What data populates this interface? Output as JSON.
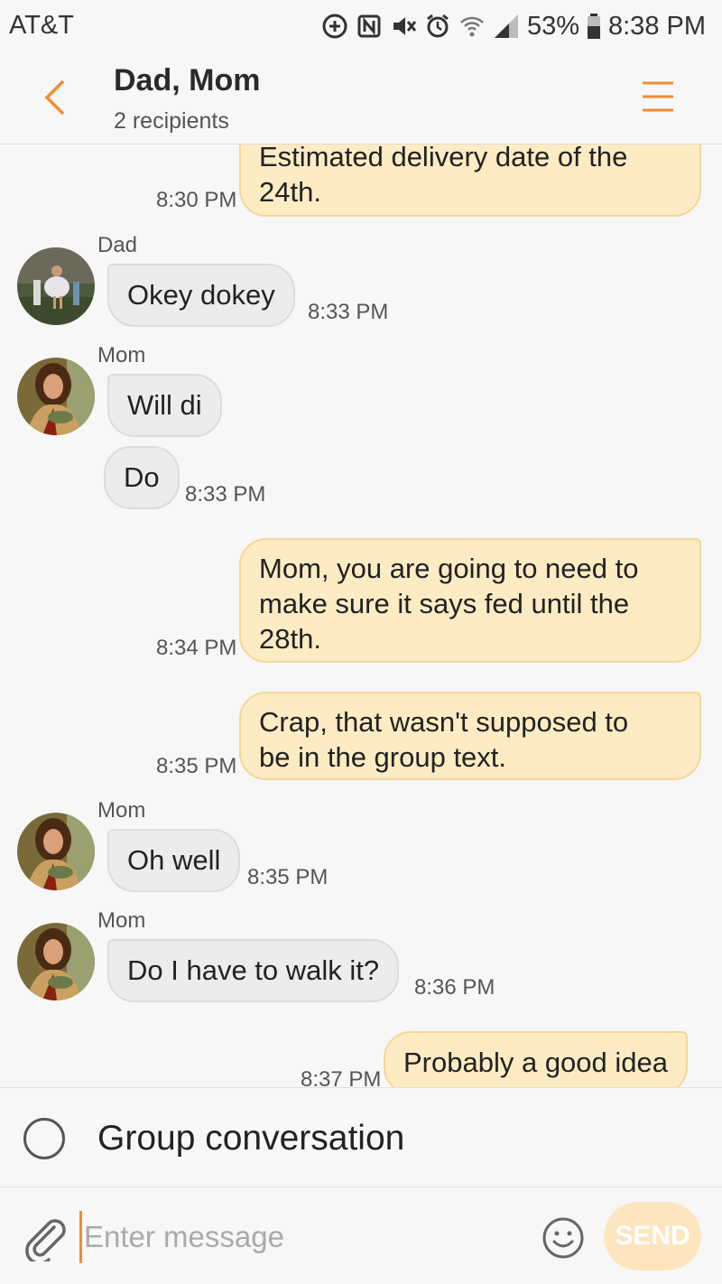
{
  "statusbar": {
    "carrier": "AT&T",
    "battery": "53%",
    "time": "8:38 PM",
    "icons": [
      "data-saver-icon",
      "nfc-icon",
      "mute-icon",
      "alarm-icon",
      "wifi-icon",
      "signal-icon",
      "battery-icon"
    ]
  },
  "header": {
    "title": "Dad, Mom",
    "subtitle": "2 recipients"
  },
  "messages": [
    {
      "dir": "out",
      "text": "Estimated delivery date of the 24th.",
      "time": "8:30 PM"
    },
    {
      "dir": "in",
      "sender": "Dad",
      "text": "Okey dokey",
      "time": "8:33 PM"
    },
    {
      "dir": "in",
      "sender": "Mom",
      "text": "Will di"
    },
    {
      "dir": "in",
      "text": "Do",
      "time": "8:33 PM"
    },
    {
      "dir": "out",
      "text": "Mom, you are going to need to make sure it says fed until the 28th.",
      "time": "8:34 PM"
    },
    {
      "dir": "out",
      "text": "Crap, that wasn't supposed to be in the group text.",
      "time": "8:35 PM"
    },
    {
      "dir": "in",
      "sender": "Mom",
      "text": "Oh well",
      "time": "8:35 PM"
    },
    {
      "dir": "in",
      "sender": "Mom",
      "text": "Do I have to walk it?",
      "time": "8:36 PM"
    },
    {
      "dir": "out",
      "text": "Probably a good idea",
      "time": "8:37 PM"
    }
  ],
  "m": {
    "m0a": "Estimated delivery date of the",
    "m0b": "24th.",
    "m4a": "Mom, you are going to need to",
    "m4b": "make sure it says fed until the",
    "m4c": "28th.",
    "m5a": "Crap, that wasn't supposed to",
    "m5b": "be in the group text."
  },
  "group": {
    "label": "Group conversation",
    "checked": false
  },
  "composer": {
    "placeholder": "Enter message",
    "send_label": "SEND"
  },
  "colors": {
    "accent": "#f08c32",
    "outgoing_bubble": "#fdebc3",
    "incoming_bubble": "#ececec",
    "send_button": "#fde6bf"
  }
}
